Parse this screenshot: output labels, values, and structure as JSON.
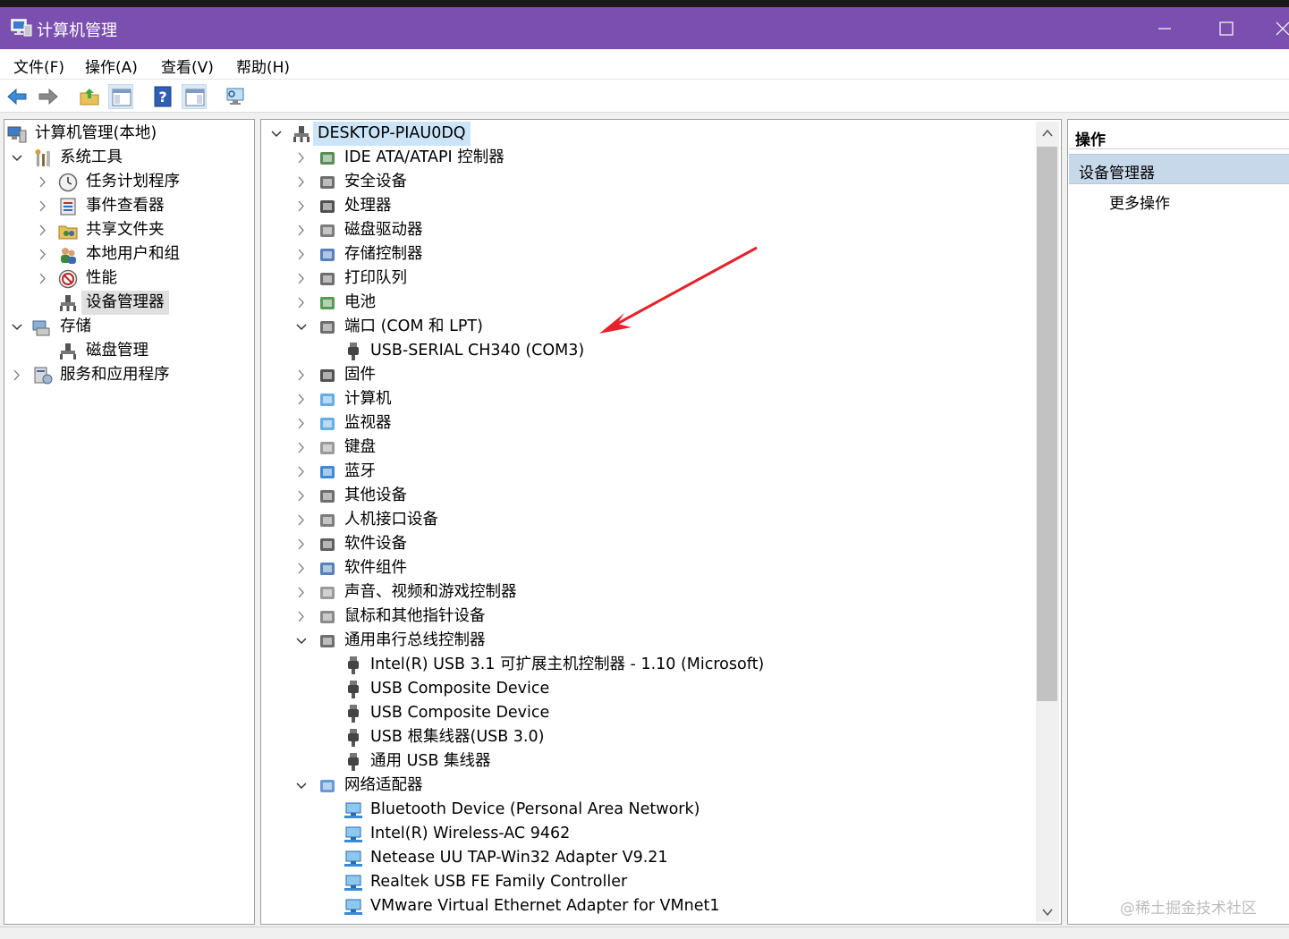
{
  "window": {
    "title": "计算机管理"
  },
  "menu": [
    "文件(F)",
    "操作(A)",
    "查看(V)",
    "帮助(H)"
  ],
  "tree": {
    "root": "计算机管理(本地)",
    "system_tools": "系统工具",
    "task_scheduler": "任务计划程序",
    "event_viewer": "事件查看器",
    "shared_folders": "共享文件夹",
    "local_users": "本地用户和组",
    "performance": "性能",
    "device_manager": "设备管理器",
    "storage": "存储",
    "disk_management": "磁盘管理",
    "services": "服务和应用程序"
  },
  "devices": {
    "computer_name": "DESKTOP-PIAU0DQ",
    "categories": [
      "IDE ATA/ATAPI 控制器",
      "安全设备",
      "处理器",
      "磁盘驱动器",
      "存储控制器",
      "打印队列",
      "电池",
      "端口 (COM 和 LPT)",
      "固件",
      "计算机",
      "监视器",
      "键盘",
      "蓝牙",
      "其他设备",
      "人机接口设备",
      "软件设备",
      "软件组件",
      "声音、视频和游戏控制器",
      "鼠标和其他指针设备",
      "通用串行总线控制器",
      "网络适配器"
    ],
    "ports_children": [
      "USB-SERIAL CH340 (COM3)"
    ],
    "usb_children": [
      "Intel(R) USB 3.1 可扩展主机控制器 - 1.10 (Microsoft)",
      "USB Composite Device",
      "USB Composite Device",
      "USB 根集线器(USB 3.0)",
      "通用 USB 集线器"
    ],
    "network_children": [
      "Bluetooth Device (Personal Area Network)",
      "Intel(R) Wireless-AC 9462",
      "Netease UU TAP-Win32 Adapter V9.21",
      "Realtek USB FE Family Controller",
      "VMware Virtual Ethernet Adapter for VMnet1"
    ]
  },
  "actions": {
    "header": "操作",
    "section": "设备管理器",
    "more": "更多操作"
  },
  "watermark": "@稀土掘金技术社区",
  "colors": {
    "titlebar": "#7b4fb0",
    "selection": "#cce4f7",
    "annotation_arrow": "#e8202a"
  }
}
